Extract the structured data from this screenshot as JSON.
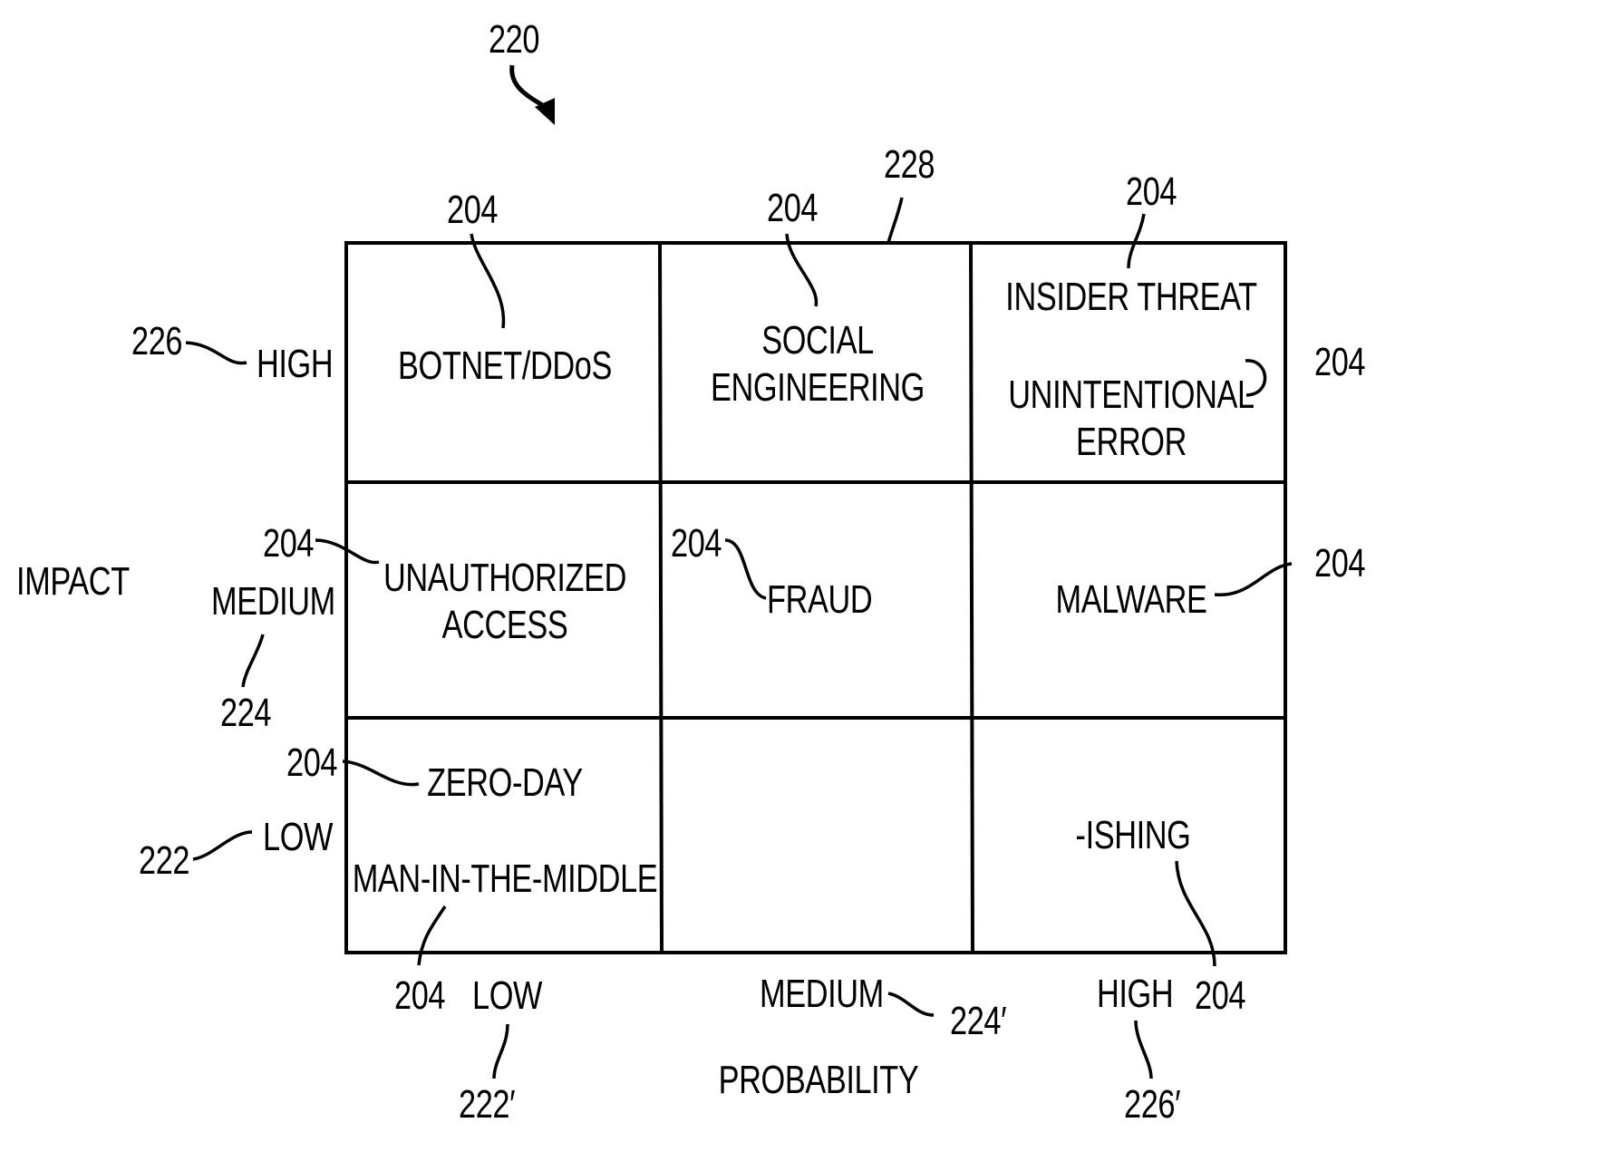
{
  "figure": {
    "reference": "220",
    "matrix_reference": "228"
  },
  "y_axis": {
    "title": "IMPACT",
    "levels": [
      {
        "label": "HIGH",
        "ref": "226"
      },
      {
        "label": "MEDIUM",
        "ref": "224"
      },
      {
        "label": "LOW",
        "ref": "222"
      }
    ]
  },
  "x_axis": {
    "title": "PROBABILITY",
    "levels": [
      {
        "label": "LOW",
        "ref": "222′"
      },
      {
        "label": "MEDIUM",
        "ref": "224′"
      },
      {
        "label": "HIGH",
        "ref": "226′"
      }
    ]
  },
  "threat_ref": "204",
  "cells": {
    "high_low": [
      "BOTNET/DDoS"
    ],
    "high_medium": [
      "SOCIAL",
      "ENGINEERING"
    ],
    "high_high_1": [
      "INSIDER THREAT"
    ],
    "high_high_2": [
      "UNINTENTIONAL",
      "ERROR"
    ],
    "medium_low": [
      "UNAUTHORIZED",
      "ACCESS"
    ],
    "medium_medium": [
      "FRAUD"
    ],
    "medium_high": [
      "MALWARE"
    ],
    "low_low_1": [
      "ZERO-DAY"
    ],
    "low_low_2": [
      "MAN-IN-THE-MIDDLE"
    ],
    "low_medium": [],
    "low_high": [
      "-ISHING"
    ]
  }
}
